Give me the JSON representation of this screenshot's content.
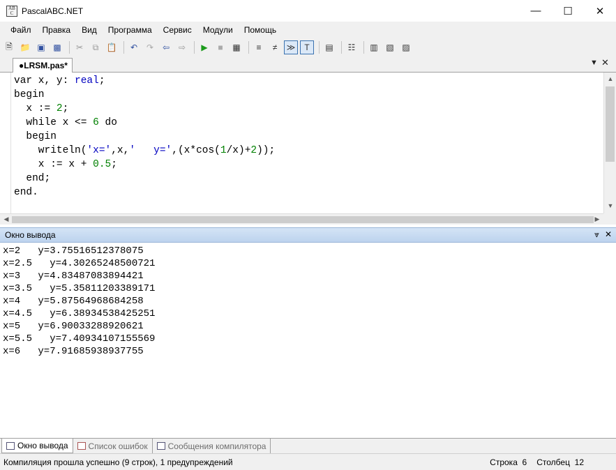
{
  "window": {
    "title": "PascalABC.NET",
    "icon_text": "AB C"
  },
  "menu": [
    "Файл",
    "Правка",
    "Вид",
    "Программа",
    "Сервис",
    "Модули",
    "Помощь"
  ],
  "tab": {
    "label": "●LRSM.pas*"
  },
  "code_lines": [
    [
      {
        "t": "var x, y: ",
        "c": "kw"
      },
      {
        "t": "real",
        "c": "ty"
      },
      {
        "t": ";",
        "c": "kw"
      }
    ],
    [
      {
        "t": "begin",
        "c": "kw"
      }
    ],
    [
      {
        "t": "  x := ",
        "c": "kw"
      },
      {
        "t": "2",
        "c": "num"
      },
      {
        "t": ";",
        "c": "kw"
      }
    ],
    [
      {
        "t": "  while x <= ",
        "c": "kw"
      },
      {
        "t": "6",
        "c": "num"
      },
      {
        "t": " do",
        "c": "kw"
      }
    ],
    [
      {
        "t": "  begin",
        "c": "kw"
      }
    ],
    [
      {
        "t": "    writeln(",
        "c": "kw"
      },
      {
        "t": "'x='",
        "c": "str"
      },
      {
        "t": ",x,",
        "c": "kw"
      },
      {
        "t": "'   y='",
        "c": "str"
      },
      {
        "t": ",(x*cos(",
        "c": "kw"
      },
      {
        "t": "1",
        "c": "num"
      },
      {
        "t": "/x)+",
        "c": "kw"
      },
      {
        "t": "2",
        "c": "num"
      },
      {
        "t": "));",
        "c": "kw"
      }
    ],
    [
      {
        "t": "    x := x + ",
        "c": "kw"
      },
      {
        "t": "0.5",
        "c": "num"
      },
      {
        "t": ";",
        "c": "kw"
      }
    ],
    [
      {
        "t": "  end;",
        "c": "kw"
      }
    ],
    [
      {
        "t": "end.",
        "c": "kw"
      }
    ]
  ],
  "output_panel": {
    "title": "Окно вывода"
  },
  "output_lines": [
    "x=2   y=3.75516512378075",
    "x=2.5   y=4.30265248500721",
    "x=3   y=4.83487083894421",
    "x=3.5   y=5.35811203389171",
    "x=4   y=5.87564968684258",
    "x=4.5   y=6.38934538425251",
    "x=5   y=6.90033288920621",
    "x=5.5   y=7.40934107155569",
    "x=6   y=7.91685938937755"
  ],
  "bottom_tabs": [
    "Окно вывода",
    "Список ошибок",
    "Сообщения компилятора"
  ],
  "status": {
    "message": "Компиляция прошла успешно (9 строк), 1 предупреждений",
    "row_label": "Строка",
    "row_value": "6",
    "col_label": "Столбец",
    "col_value": "12"
  }
}
